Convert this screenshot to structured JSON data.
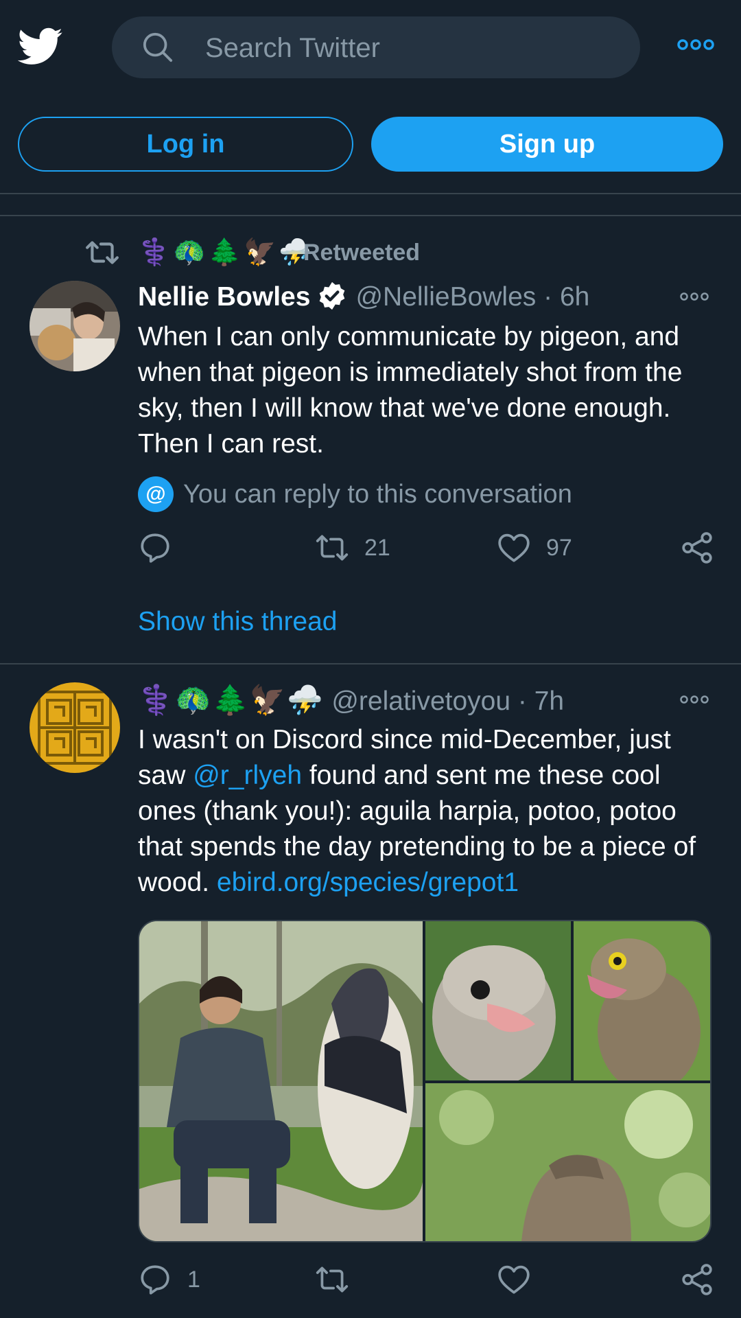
{
  "colors": {
    "background": "#15202b",
    "accent": "#1da1f2",
    "muted_text": "#8899a6",
    "divider": "#38444d",
    "search_bg": "#253341"
  },
  "header": {
    "logo_icon": "twitter-bird-icon",
    "search_placeholder": "Search Twitter",
    "more_icon": "more-horizontal-icon"
  },
  "auth": {
    "login_label": "Log in",
    "signup_label": "Sign up"
  },
  "tweets": [
    {
      "retweeted_by_emojis": [
        "⚕️",
        "🦚",
        "🌲",
        "🦅",
        "⛈️"
      ],
      "retweeted_label": "Retweeted",
      "name": "Nellie Bowles",
      "verified": true,
      "handle": "@NellieBowles",
      "separator": "·",
      "time": "6h",
      "text": "When I can only communicate by pigeon, and when that pigeon is immediately shot from the sky, then I will know that we've done enough. Then I can rest.",
      "reply_note": "You can reply to this conversation",
      "reply_note_icon": "@",
      "reply_count": "",
      "retweet_count": "21",
      "like_count": "97",
      "show_thread_label": "Show this thread"
    },
    {
      "name_emojis": [
        "⚕️",
        "🦚",
        "🌲",
        "🦅",
        "⛈️"
      ],
      "handle": "@relativetoyou",
      "separator": "·",
      "time": "7h",
      "text_part1": "I wasn't on Discord since mid-December, just saw ",
      "mention": "@r_rlyeh",
      "text_part2": " found and sent me these cool ones (thank you!): aguila harpia, potoo, potoo that spends the day pretending to be a piece of wood. ",
      "link": "ebird.org/species/grepot1",
      "reply_count": "1",
      "retweet_count": "",
      "like_count": ""
    }
  ]
}
